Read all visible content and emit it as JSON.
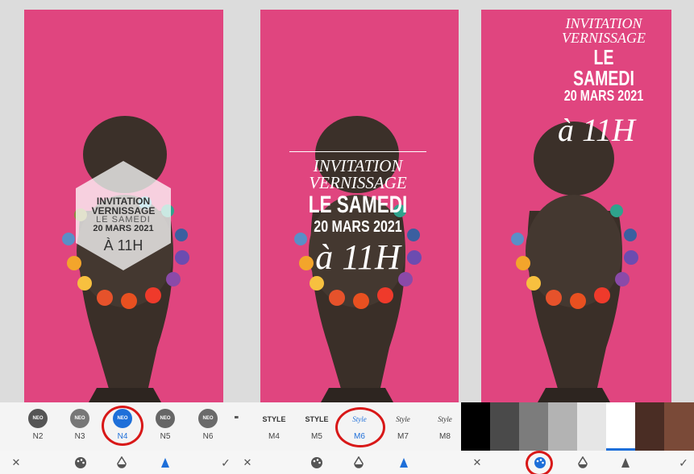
{
  "panel1": {
    "overlay_lines": [
      "INVITATION",
      "VERNISSAGE",
      "LE SAMEDI",
      "20 MARS 2021",
      "À 11H"
    ],
    "thumbs": [
      {
        "badge": "NEO",
        "label": "N2"
      },
      {
        "badge": "NEO",
        "label": "N3"
      },
      {
        "badge": "NEO",
        "label": "N4"
      },
      {
        "badge": "NEO",
        "label": "N5"
      },
      {
        "badge": "NEO",
        "label": "N6"
      }
    ],
    "selected_color": "#1e6fd9"
  },
  "panel2": {
    "overlay_lines": [
      "INVITATION",
      "VERNISSAGE",
      "LE SAMEDI",
      "20 MARS 2021",
      "à 11H"
    ],
    "thumbs": [
      {
        "text": "STYLE",
        "label": "M4"
      },
      {
        "text": "STYLE",
        "label": "M5"
      },
      {
        "text": "Style",
        "label": "M6"
      },
      {
        "text": "Style",
        "label": "M7"
      },
      {
        "text": "Style",
        "label": "M8"
      }
    ]
  },
  "panel3": {
    "overlay_lines": [
      "INVITATION",
      "VERNISSAGE",
      "LE SAMEDI",
      "20 MARS 2021",
      "à 11H"
    ],
    "swatches": [
      "#000000",
      "#4a4a4a",
      "#7c7c7c",
      "#b3b3b3",
      "#e6e6e6",
      "#ffffff",
      "#4a2d24",
      "#7a4a38"
    ]
  },
  "toolbar": {
    "close_glyph": "✕",
    "apply_glyph": "✓"
  },
  "colors": {
    "accent_red": "#d81818",
    "accent_blue": "#1e6fd9",
    "photo_pink": "#e0457f"
  }
}
